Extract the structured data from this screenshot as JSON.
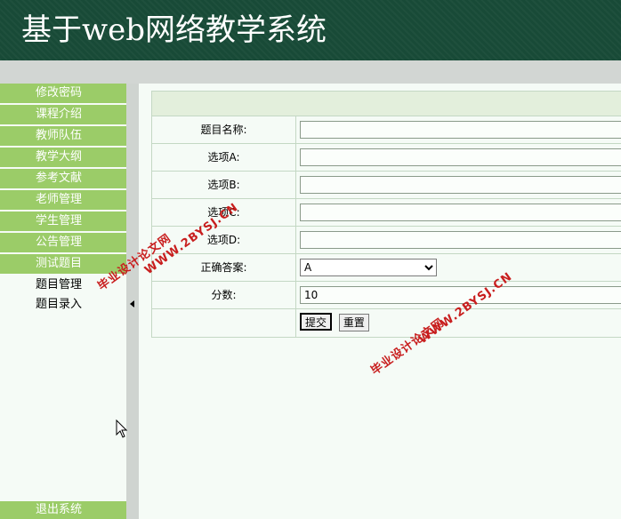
{
  "header": {
    "title": "基于web网络教学系统"
  },
  "sidebar": {
    "items": [
      {
        "label": "修改密码"
      },
      {
        "label": "课程介绍"
      },
      {
        "label": "教师队伍"
      },
      {
        "label": "教学大纲"
      },
      {
        "label": "参考文献"
      },
      {
        "label": "老师管理"
      },
      {
        "label": "学生管理"
      },
      {
        "label": "公告管理"
      },
      {
        "label": "测试题目"
      }
    ],
    "subitems": [
      {
        "label": "题目管理"
      },
      {
        "label": "题目录入"
      }
    ],
    "logout_label": "退出系统"
  },
  "form": {
    "fields": {
      "title": {
        "label": "题目名称:",
        "value": ""
      },
      "option_a": {
        "label": "选项A:",
        "value": ""
      },
      "option_b": {
        "label": "选项B:",
        "value": ""
      },
      "option_c": {
        "label": "选项C:",
        "value": ""
      },
      "option_d": {
        "label": "选项D:",
        "value": ""
      },
      "answer": {
        "label": "正确答案:",
        "selected": "A"
      },
      "score": {
        "label": "分数:",
        "value": "10"
      }
    },
    "submit_label": "提交",
    "reset_label": "重置"
  },
  "watermark": {
    "line1": "毕业设计论文网",
    "line2": "WWW.2BYSJ.CN"
  },
  "colors": {
    "banner": "#184a37",
    "menu": "#9bcc68",
    "watermark": "#c81e1e"
  }
}
